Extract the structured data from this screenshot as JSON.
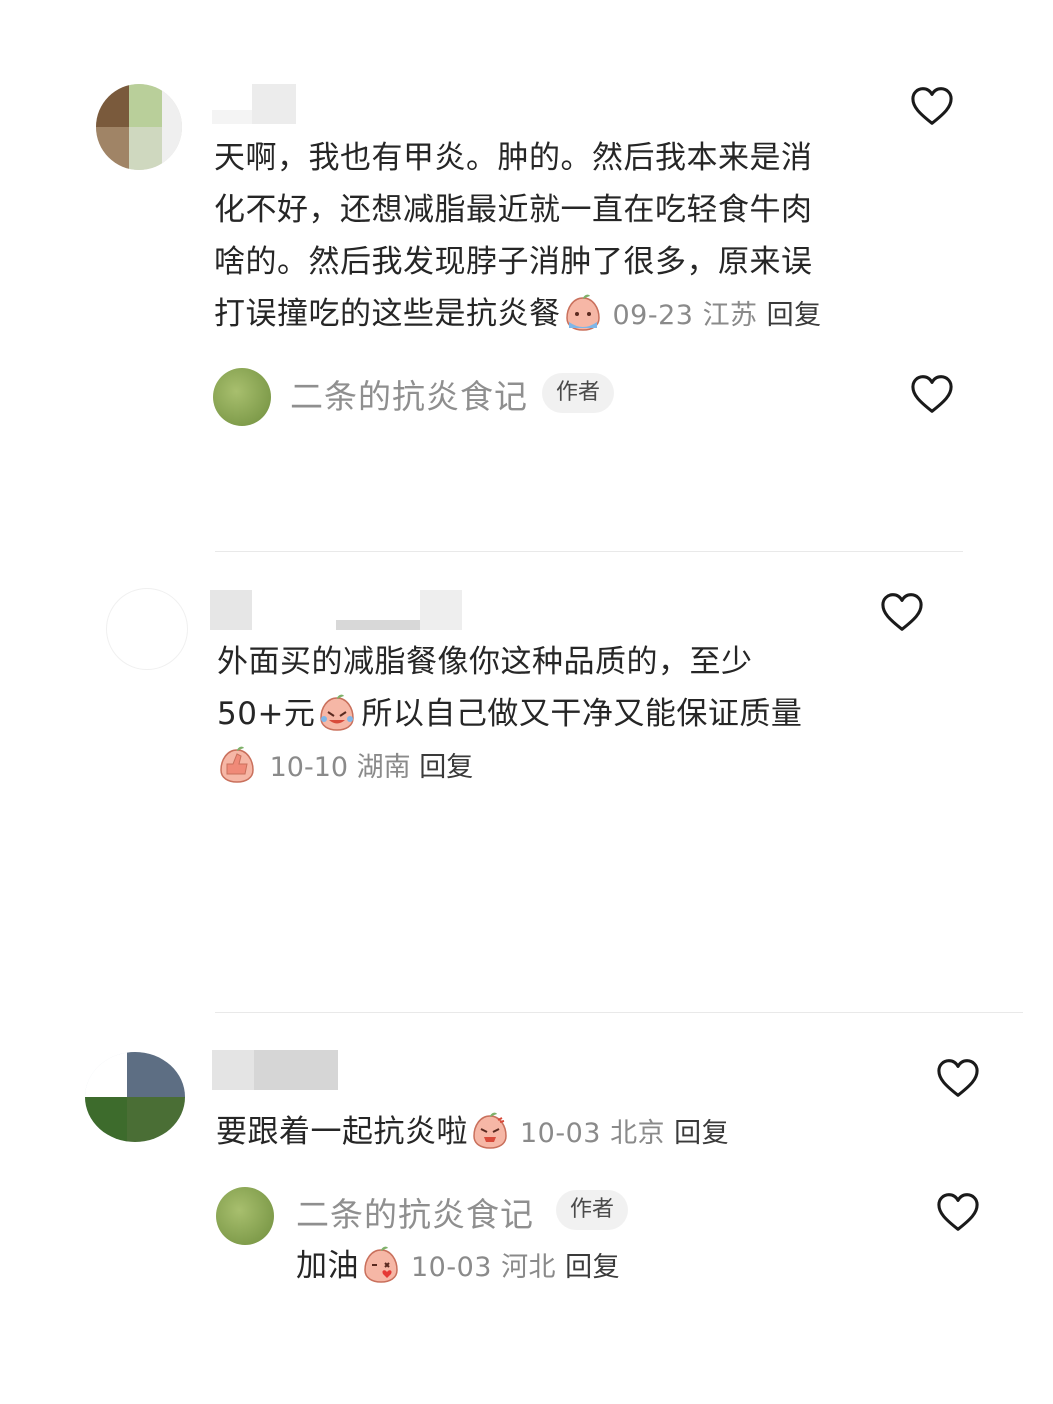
{
  "comments": [
    {
      "text": "天啊，我也有甲炎。肿的。然后我本来是消化不好，还想减脂最近就一直在吃轻食牛肉啥的。然后我发现脖子消肿了很多，原来误打误撞吃的这些是抗炎餐",
      "lines": [
        "天啊，我也有甲炎。肿的。然后我本来是消",
        "化不好，还想减脂最近就一直在吃轻食牛肉",
        "啥的。然后我发现脖子消肿了很多，原来误",
        "打误撞吃的这些是抗炎餐"
      ],
      "emoji": "crying-face-emoji",
      "date": "09-23",
      "location": "江苏",
      "reply_label": "回复",
      "reply": {
        "author": "二条的抗炎食记",
        "badge": "作者"
      }
    },
    {
      "lines": [
        "外面买的减脂餐像你这种品质的，至少",
        "50+元",
        "所以自己做又干净又能保证质量"
      ],
      "emoji_inline": "laughing-tears-emoji",
      "emoji_leading": "thumbs-up-emoji",
      "date": "10-10",
      "location": "湖南",
      "reply_label": "回复"
    },
    {
      "text": "要跟着一起抗炎啦",
      "emoji": "angry-face-emoji",
      "date": "10-03",
      "location": "北京",
      "reply_label": "回复",
      "reply": {
        "author": "二条的抗炎食记",
        "badge": "作者",
        "text": "加油",
        "emoji": "kiss-heart-emoji",
        "date": "10-03",
        "location": "河北",
        "reply_label": "回复"
      }
    }
  ],
  "icons": {
    "like": "heart-outline-icon"
  },
  "colors": {
    "text": "#262626",
    "meta": "#8a8a8a",
    "author": "#8f8f8f",
    "badge_bg": "#f1f1f1"
  }
}
